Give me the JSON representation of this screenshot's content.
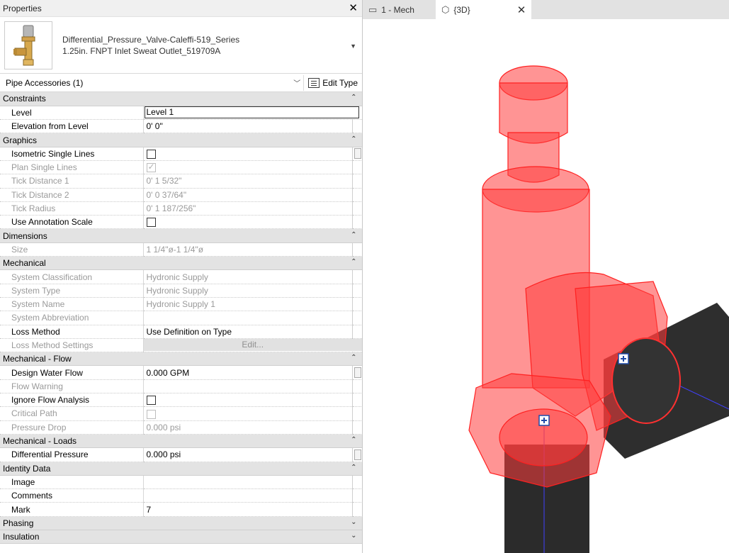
{
  "properties_panel": {
    "title": "Properties",
    "close_icon": "close-icon",
    "type_selector": {
      "line1": "Differential_Pressure_Valve-Caleffi-519_Series",
      "line2": "1.25in. FNPT Inlet Sweat Outlet_519709A"
    },
    "filter": "Pipe Accessories (1)",
    "edit_type": "Edit Type"
  },
  "groups": {
    "constraints": "Constraints",
    "graphics": "Graphics",
    "dimensions": "Dimensions",
    "mechanical": "Mechanical",
    "mechanical_flow": "Mechanical - Flow",
    "mechanical_loads": "Mechanical - Loads",
    "identity_data": "Identity Data",
    "phasing": "Phasing",
    "insulation": "Insulation"
  },
  "rows": {
    "level": {
      "name": "Level",
      "value": "Level 1"
    },
    "elevation": {
      "name": "Elevation from Level",
      "value": "0'  0\""
    },
    "iso_single": {
      "name": "Isometric Single Lines"
    },
    "plan_single": {
      "name": "Plan Single Lines"
    },
    "tick1": {
      "name": "Tick Distance 1",
      "value": "0'  1 5/32\""
    },
    "tick2": {
      "name": "Tick Distance 2",
      "value": "0'  0 37/64\""
    },
    "tick_radius": {
      "name": "Tick Radius",
      "value": "0'  1 187/256\""
    },
    "use_annot": {
      "name": "Use Annotation Scale"
    },
    "size": {
      "name": "Size",
      "value": "1 1/4\"ø-1 1/4\"ø"
    },
    "sys_class": {
      "name": "System Classification",
      "value": "Hydronic Supply"
    },
    "sys_type": {
      "name": "System Type",
      "value": "Hydronic Supply"
    },
    "sys_name": {
      "name": "System Name",
      "value": "Hydronic Supply 1"
    },
    "sys_abbrev": {
      "name": "System Abbreviation",
      "value": ""
    },
    "loss_method": {
      "name": "Loss Method",
      "value": "Use Definition on Type"
    },
    "loss_settings": {
      "name": "Loss Method Settings",
      "value": "Edit..."
    },
    "design_flow": {
      "name": "Design Water Flow",
      "value": "0.000 GPM"
    },
    "flow_warning": {
      "name": "Flow Warning",
      "value": ""
    },
    "ignore_flow": {
      "name": "Ignore Flow Analysis"
    },
    "critical_path": {
      "name": "Critical Path"
    },
    "pressure_drop": {
      "name": "Pressure Drop",
      "value": "0.000 psi"
    },
    "diff_pressure": {
      "name": "Differential Pressure",
      "value": "0.000 psi"
    },
    "image": {
      "name": "Image",
      "value": ""
    },
    "comments": {
      "name": "Comments",
      "value": ""
    },
    "mark": {
      "name": "Mark",
      "value": "7"
    }
  },
  "tabs": [
    {
      "label": "1 - Mech",
      "icon": "floor-plan-icon"
    },
    {
      "label": "{3D}",
      "icon": "3d-view-icon"
    }
  ],
  "colors": {
    "selection_red": "#ff3b3b",
    "pipe_dark": "#2b2b2b",
    "centerline_blue": "#3a3aff"
  }
}
